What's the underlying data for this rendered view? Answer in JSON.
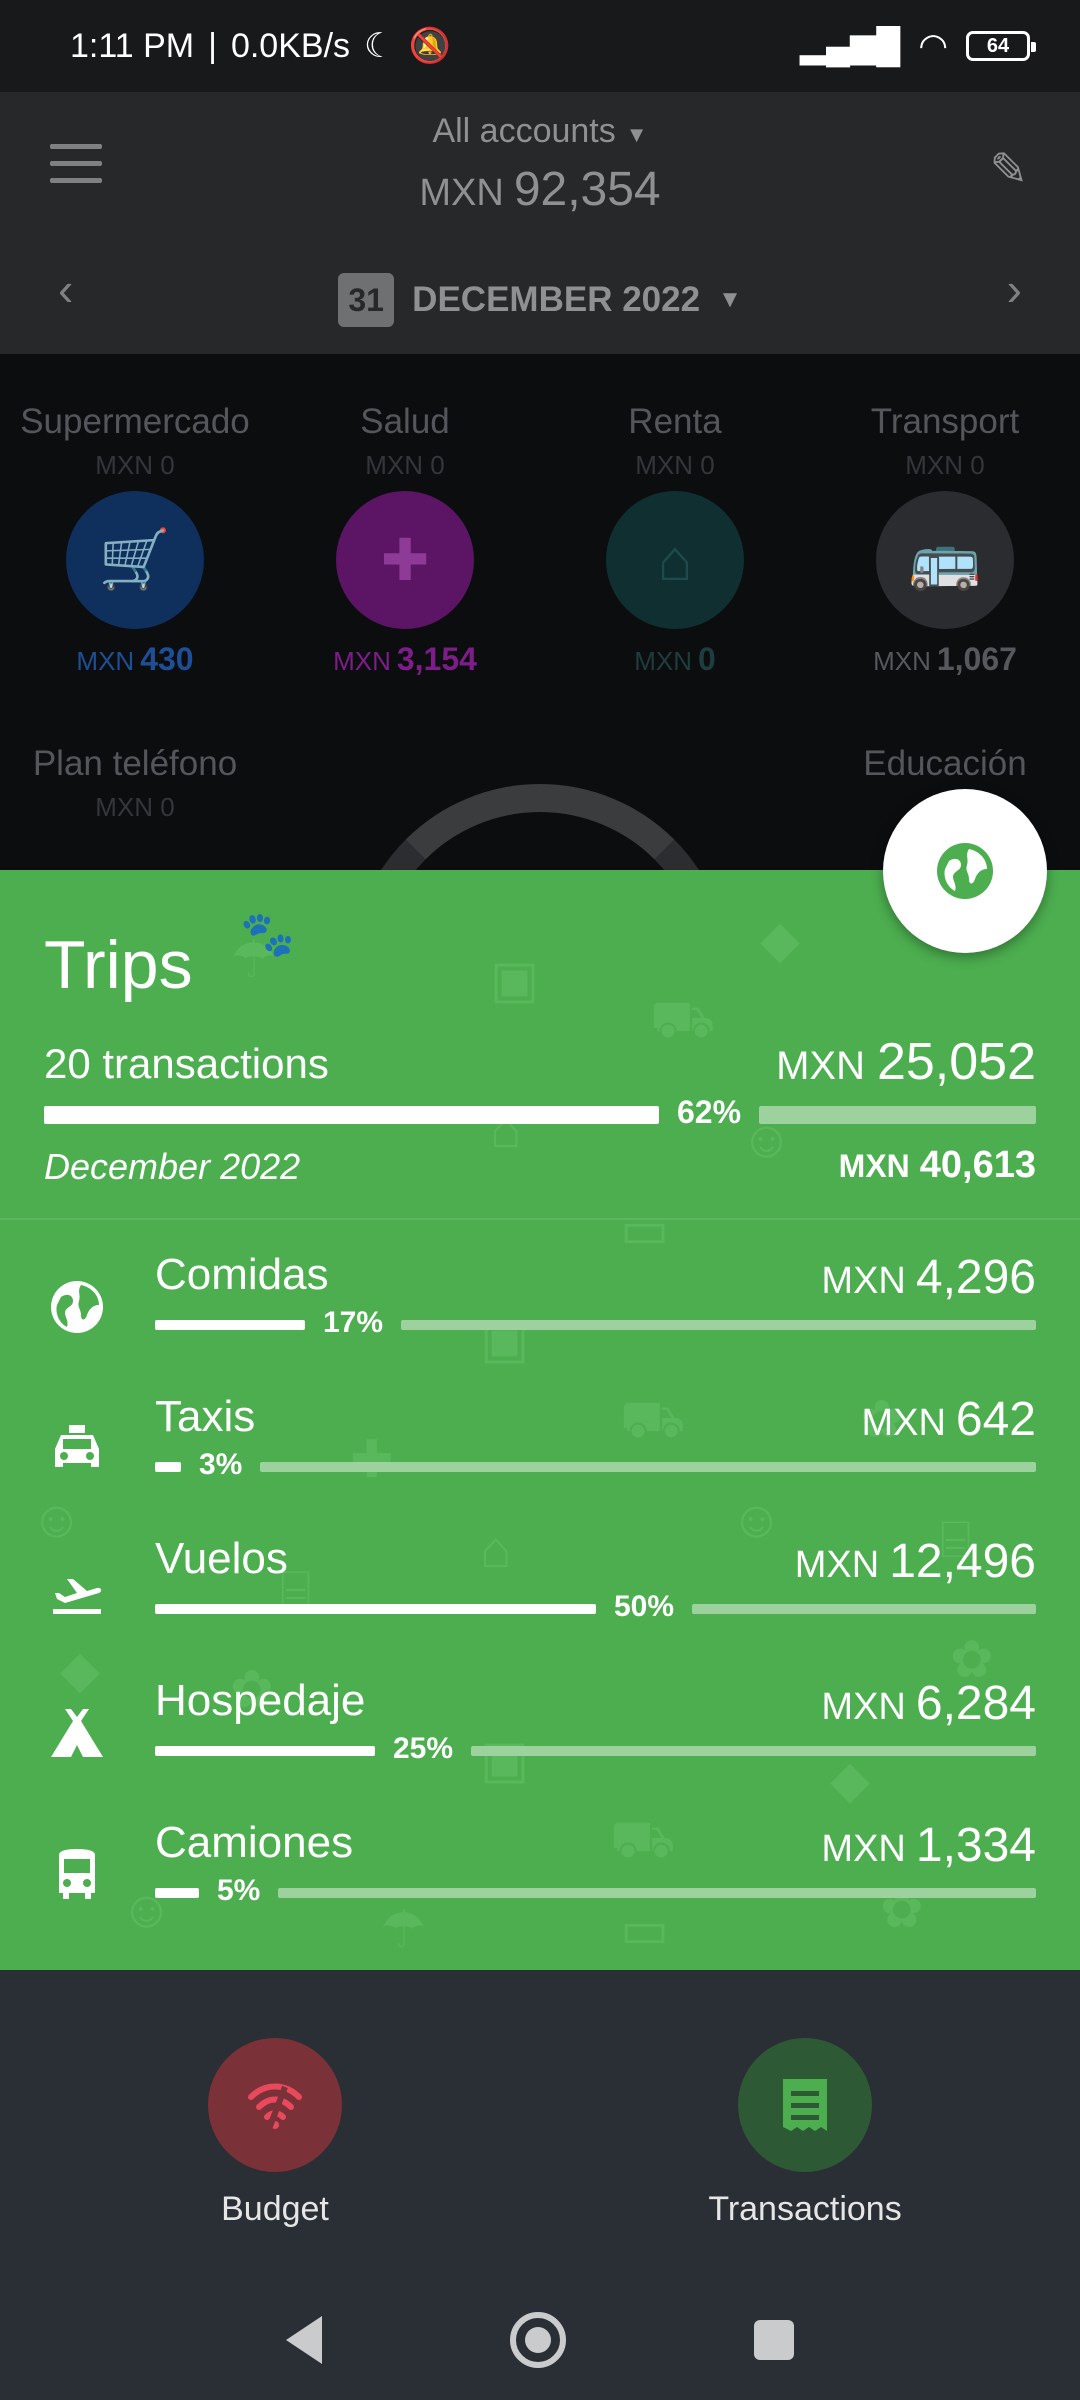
{
  "status": {
    "time": "1:11 PM",
    "speed": "0.0KB/s",
    "battery": "64"
  },
  "header": {
    "account": "All accounts",
    "currency": "MXN",
    "balance": "92,354",
    "date_icon": "31",
    "period": "DECEMBER 2022"
  },
  "categories": [
    {
      "name": "Supermercado",
      "budget": "MXN 0",
      "spent_currency": "MXN",
      "spent": "430",
      "color": "#1a4ea8",
      "text_color": "#1e4f96",
      "icon": "cart-icon"
    },
    {
      "name": "Salud",
      "budget": "MXN 0",
      "spent_currency": "MXN",
      "spent": "3,154",
      "color": "#8e1f9a",
      "text_color": "#7d1d8a",
      "icon": "bandage-icon"
    },
    {
      "name": "Renta",
      "budget": "MXN 0",
      "spent_currency": "MXN",
      "spent": "0",
      "color": "#174a4b",
      "text_color": "#1f3d3e",
      "icon": "home-icon"
    },
    {
      "name": "Transport",
      "budget": "MXN 0",
      "spent_currency": "MXN",
      "spent": "1,067",
      "color": "#3d3f42",
      "text_color": "#55585c",
      "icon": "bus-icon"
    },
    {
      "name": "Plan teléfono",
      "budget": "MXN 0"
    },
    {
      "name": "Educación",
      "budget": ""
    }
  ],
  "trip": {
    "title": "Trips",
    "transactions": "20 transactions",
    "currency": "MXN",
    "total": "25,052",
    "percent": "62%",
    "progress": 0.62,
    "period": "December 2022",
    "budget_currency": "MXN",
    "budget": "40,613"
  },
  "subcategories": [
    {
      "name": "Comidas",
      "currency": "MXN",
      "amount": "4,296",
      "percent": "17%",
      "progress": 0.17,
      "icon": "globe-icon"
    },
    {
      "name": "Taxis",
      "currency": "MXN",
      "amount": "642",
      "percent": "3%",
      "progress": 0.03,
      "icon": "taxi-icon"
    },
    {
      "name": "Vuelos",
      "currency": "MXN",
      "amount": "12,496",
      "percent": "50%",
      "progress": 0.5,
      "icon": "plane-icon"
    },
    {
      "name": "Hospedaje",
      "currency": "MXN",
      "amount": "6,284",
      "percent": "25%",
      "progress": 0.25,
      "icon": "tent-icon"
    },
    {
      "name": "Camiones",
      "currency": "MXN",
      "amount": "1,334",
      "percent": "5%",
      "progress": 0.05,
      "icon": "bus-icon"
    }
  ],
  "bottom_nav": {
    "budget": "Budget",
    "transactions": "Transactions",
    "budget_color": "#7b3138",
    "transactions_color": "#2d5a35"
  }
}
